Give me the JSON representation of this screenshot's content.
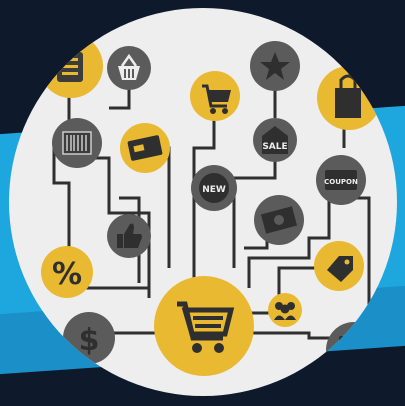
{
  "labels": {
    "sale": "SALE",
    "new": "NEW",
    "coupon": "COUPON",
    "percent": "%",
    "dollar": "$"
  },
  "colors": {
    "background_dark": "#0e1a2b",
    "stripe_blue": "#1ea7df",
    "circle_bg": "#eeeeee",
    "accent_yellow": "#e9b931",
    "node_gray": "#5b5b5b",
    "node_dark": "#3c3c3c",
    "line": "#2f2f2f"
  },
  "icons": [
    "shopping-basket-icon",
    "star-icon",
    "shopping-cart-icon",
    "shopping-bag-icon",
    "credit-card-icon",
    "barcode-icon",
    "sale-tag-icon",
    "new-badge-icon",
    "coupon-icon",
    "cash-icon",
    "thumbs-up-icon",
    "price-tag-icon",
    "percent-icon",
    "dollar-icon",
    "users-icon",
    "calculator-icon",
    "clipboard-icon"
  ]
}
